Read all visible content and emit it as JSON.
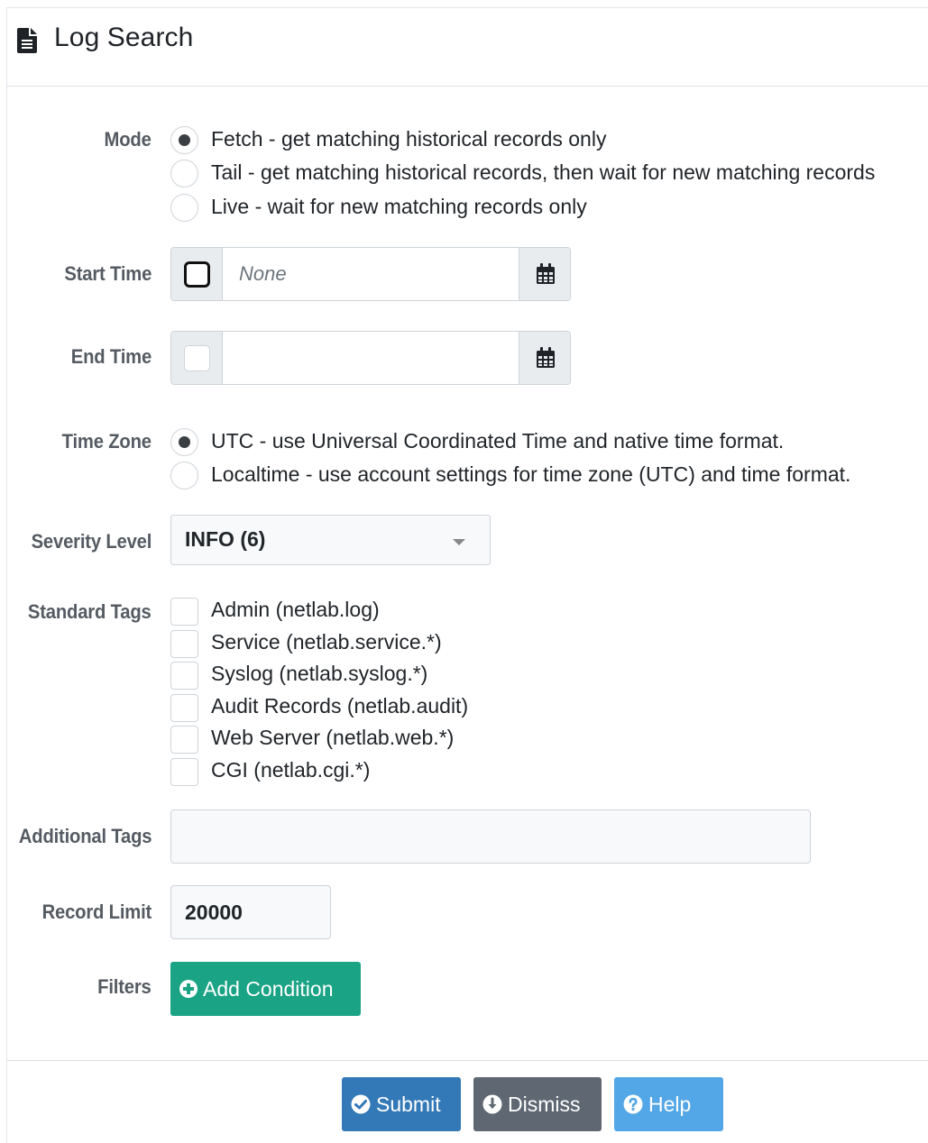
{
  "header": {
    "title": "Log Search",
    "icon": "file-text-icon"
  },
  "form": {
    "mode": {
      "label": "Mode",
      "options": [
        {
          "text": "Fetch - get matching historical records only",
          "checked": true
        },
        {
          "text": "Tail - get matching historical records, then wait for new matching records",
          "checked": false
        },
        {
          "text": "Live - wait for new matching records only",
          "checked": false
        }
      ]
    },
    "start_time": {
      "label": "Start Time",
      "placeholder": "None",
      "value": "",
      "enabled": false
    },
    "end_time": {
      "label": "End Time",
      "placeholder": "",
      "value": "",
      "enabled": false
    },
    "time_zone": {
      "label": "Time Zone",
      "options": [
        {
          "text": "UTC - use Universal Coordinated Time and native time format.",
          "checked": true
        },
        {
          "text": "Localtime - use account settings for time zone (UTC) and time format.",
          "checked": false
        }
      ]
    },
    "severity": {
      "label": "Severity Level",
      "value": "INFO (6)"
    },
    "standard_tags": {
      "label": "Standard Tags",
      "items": [
        {
          "text": "Admin (netlab.log)",
          "checked": false
        },
        {
          "text": "Service (netlab.service.*)",
          "checked": false
        },
        {
          "text": "Syslog (netlab.syslog.*)",
          "checked": false
        },
        {
          "text": "Audit Records (netlab.audit)",
          "checked": false
        },
        {
          "text": "Web Server (netlab.web.*)",
          "checked": false
        },
        {
          "text": "CGI (netlab.cgi.*)",
          "checked": false
        }
      ]
    },
    "additional_tags": {
      "label": "Additional Tags",
      "value": ""
    },
    "record_limit": {
      "label": "Record Limit",
      "value": "20000"
    },
    "filters": {
      "label": "Filters",
      "add_button": "Add Condition"
    }
  },
  "footer": {
    "submit": "Submit",
    "dismiss": "Dismiss",
    "help": "Help"
  },
  "colors": {
    "add_button": "#1aa384",
    "submit": "#3479b7",
    "dismiss": "#5e6772",
    "help": "#54a7e6"
  }
}
